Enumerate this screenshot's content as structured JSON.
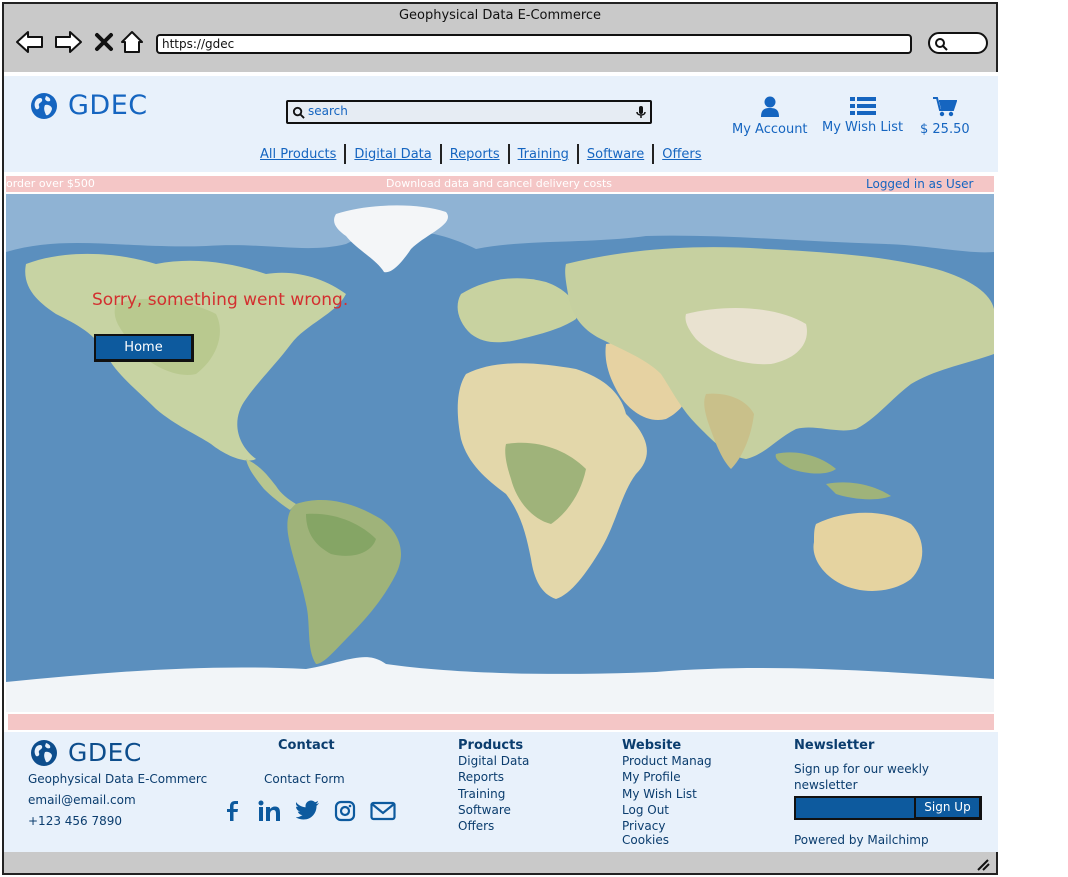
{
  "browser": {
    "title": "Geophysical Data E-Commerce",
    "url": "https://gdec"
  },
  "header": {
    "logo_text": "GDEC",
    "search_placeholder": "search",
    "account_label": "My Account",
    "wishlist_label": "My Wish List",
    "cart_total": "$ 25.50"
  },
  "nav": {
    "items": [
      "All Products",
      "Digital Data",
      "Reports",
      "Training",
      "Software",
      "Offers"
    ]
  },
  "promo": {
    "left": "order over $500",
    "center": "Download data and cancel delivery costs",
    "right": "Logged in as User"
  },
  "hero": {
    "error_message": "Sorry, something went wrong.",
    "home_button": "Home"
  },
  "footer": {
    "logo_text": "GDEC",
    "company": "Geophysical Data E-Commerc",
    "email": "email@email.com",
    "phone": "+123 456 7890",
    "contact_heading": "Contact",
    "contact_form": "Contact Form",
    "products_heading": "Products",
    "products": [
      "Digital Data",
      "Reports",
      "Training",
      "Software",
      "Offers"
    ],
    "website_heading": "Website",
    "website": [
      "Product Manag",
      "My Profile",
      "My Wish List",
      "Log Out",
      "Privacy",
      "Cookies"
    ],
    "newsletter_heading": "Newsletter",
    "newsletter_text_1": "Sign up for our weekly",
    "newsletter_text_2": "newsletter",
    "signup_button": "Sign Up",
    "powered_by": "Powered by Mailchimp"
  },
  "colors": {
    "brand_blue": "#1565c0",
    "dark_blue": "#0d5a9e",
    "header_bg": "#e8f1fb",
    "promo_pink": "#f4c6c6",
    "error_red": "#d32f2f"
  },
  "icons": [
    "back-icon",
    "forward-icon",
    "close-icon",
    "home-icon",
    "globe-icon",
    "search-icon",
    "microphone-icon",
    "user-icon",
    "list-icon",
    "cart-icon",
    "facebook-icon",
    "linkedin-icon",
    "twitter-icon",
    "instagram-icon",
    "mail-icon",
    "resize-icon"
  ]
}
